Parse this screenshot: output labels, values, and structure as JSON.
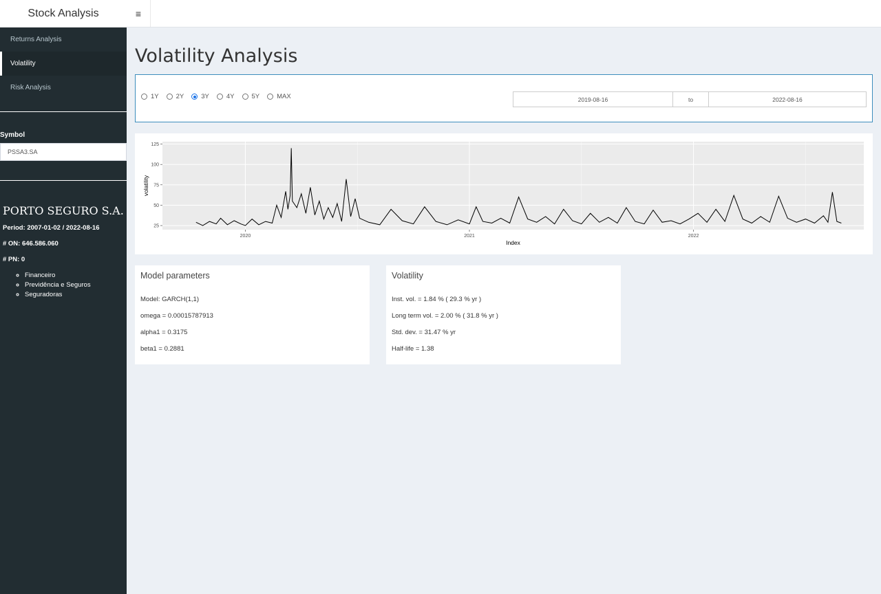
{
  "header": {
    "title": "Stock Analysis",
    "toggle_icon": "≡"
  },
  "sidebar": {
    "menu": [
      {
        "label": "Returns Analysis",
        "active": false
      },
      {
        "label": "Volatility",
        "active": true
      },
      {
        "label": "Risk Analysis",
        "active": false
      }
    ],
    "symbol_label": "Symbol",
    "symbol_value": "PSSA3.SA",
    "company": "PORTO SEGURO S.A.",
    "period": "Period: 2007-01-02 / 2022-08-16",
    "on": "# ON: 646.586.060",
    "pn": "# PN: 0",
    "sectors": [
      "Financeiro",
      "Previdência e Seguros",
      "Seguradoras"
    ]
  },
  "main": {
    "title": "Volatility Analysis",
    "ranges": [
      {
        "label": "1Y",
        "selected": false
      },
      {
        "label": "2Y",
        "selected": false
      },
      {
        "label": "3Y",
        "selected": true
      },
      {
        "label": "4Y",
        "selected": false
      },
      {
        "label": "5Y",
        "selected": false
      },
      {
        "label": "MAX",
        "selected": false
      }
    ],
    "date_from": "2019-08-16",
    "date_sep": "to",
    "date_to": "2022-08-16"
  },
  "model_card": {
    "title": "Model parameters",
    "lines": [
      "Model: GARCH(1,1)",
      "omega = 0.00015787913",
      "alpha1 = 0.3175",
      "beta1 = 0.2881"
    ]
  },
  "vol_card": {
    "title": "Volatility",
    "lines": [
      "Inst. vol. = 1.84 % ( 29.3 % yr )",
      "Long term vol. = 2.00 % ( 31.8 % yr )",
      "Std. dev. = 31.47 % yr",
      "Half-life = 1.38"
    ]
  },
  "chart_data": {
    "type": "line",
    "xlabel": "Index",
    "ylabel": "volatility",
    "x_ticks": [
      "2020",
      "2021",
      "2022"
    ],
    "y_ticks": [
      25,
      50,
      75,
      100,
      125
    ],
    "ylim": [
      20,
      128
    ],
    "xlim": [
      2019.63,
      2022.76
    ],
    "grid": true,
    "series": [
      {
        "points": [
          [
            2019.78,
            29
          ],
          [
            2019.81,
            25
          ],
          [
            2019.84,
            30
          ],
          [
            2019.87,
            27
          ],
          [
            2019.89,
            34
          ],
          [
            2019.92,
            26
          ],
          [
            2019.95,
            31
          ],
          [
            2019.98,
            27
          ],
          [
            2020.0,
            25
          ],
          [
            2020.03,
            33
          ],
          [
            2020.06,
            26
          ],
          [
            2020.09,
            30
          ],
          [
            2020.12,
            28
          ],
          [
            2020.14,
            50
          ],
          [
            2020.16,
            35
          ],
          [
            2020.18,
            67
          ],
          [
            2020.19,
            45
          ],
          [
            2020.2,
            62
          ],
          [
            2020.205,
            120
          ],
          [
            2020.21,
            55
          ],
          [
            2020.23,
            47
          ],
          [
            2020.25,
            64
          ],
          [
            2020.27,
            40
          ],
          [
            2020.29,
            72
          ],
          [
            2020.31,
            38
          ],
          [
            2020.33,
            55
          ],
          [
            2020.35,
            33
          ],
          [
            2020.37,
            47
          ],
          [
            2020.39,
            35
          ],
          [
            2020.41,
            52
          ],
          [
            2020.43,
            30
          ],
          [
            2020.45,
            82
          ],
          [
            2020.47,
            36
          ],
          [
            2020.49,
            58
          ],
          [
            2020.51,
            34
          ],
          [
            2020.55,
            29
          ],
          [
            2020.6,
            26
          ],
          [
            2020.65,
            45
          ],
          [
            2020.7,
            31
          ],
          [
            2020.75,
            27
          ],
          [
            2020.8,
            48
          ],
          [
            2020.85,
            30
          ],
          [
            2020.9,
            26
          ],
          [
            2020.95,
            32
          ],
          [
            2021.0,
            27
          ],
          [
            2021.03,
            48
          ],
          [
            2021.06,
            30
          ],
          [
            2021.1,
            28
          ],
          [
            2021.14,
            34
          ],
          [
            2021.18,
            28
          ],
          [
            2021.22,
            60
          ],
          [
            2021.26,
            33
          ],
          [
            2021.3,
            29
          ],
          [
            2021.34,
            36
          ],
          [
            2021.38,
            27
          ],
          [
            2021.42,
            45
          ],
          [
            2021.46,
            31
          ],
          [
            2021.5,
            27
          ],
          [
            2021.54,
            40
          ],
          [
            2021.58,
            29
          ],
          [
            2021.62,
            35
          ],
          [
            2021.66,
            28
          ],
          [
            2021.7,
            47
          ],
          [
            2021.74,
            30
          ],
          [
            2021.78,
            27
          ],
          [
            2021.82,
            44
          ],
          [
            2021.86,
            29
          ],
          [
            2021.9,
            31
          ],
          [
            2021.94,
            27
          ],
          [
            2021.98,
            33
          ],
          [
            2022.02,
            40
          ],
          [
            2022.06,
            29
          ],
          [
            2022.1,
            45
          ],
          [
            2022.14,
            30
          ],
          [
            2022.18,
            62
          ],
          [
            2022.22,
            33
          ],
          [
            2022.26,
            28
          ],
          [
            2022.3,
            36
          ],
          [
            2022.34,
            29
          ],
          [
            2022.38,
            61
          ],
          [
            2022.42,
            34
          ],
          [
            2022.46,
            29
          ],
          [
            2022.5,
            33
          ],
          [
            2022.54,
            28
          ],
          [
            2022.58,
            37
          ],
          [
            2022.6,
            29
          ],
          [
            2022.62,
            66
          ],
          [
            2022.64,
            30
          ],
          [
            2022.66,
            28
          ]
        ]
      }
    ]
  }
}
